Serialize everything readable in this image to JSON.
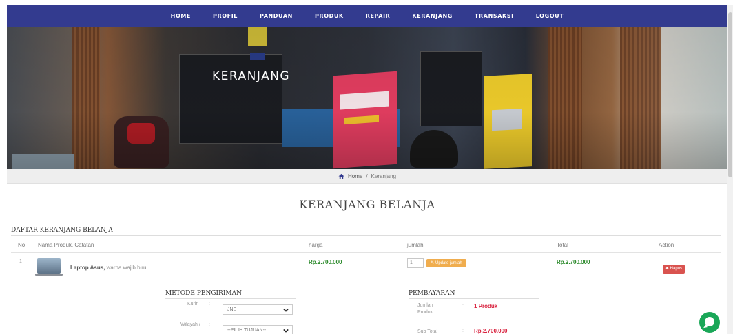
{
  "nav": {
    "items": [
      "HOME",
      "PROFIL",
      "PANDUAN",
      "PRODUK",
      "REPAIR",
      "KERANJANG",
      "TRANSAKSI",
      "LOGOUT"
    ]
  },
  "hero": {
    "title": "KERANJANG"
  },
  "breadcrumb": {
    "icon": "home-icon",
    "home": "Home",
    "separator": "/",
    "current": "Keranjang"
  },
  "page": {
    "heading": "KERANJANG BELANJA"
  },
  "cart": {
    "title": "DAFTAR KERANJANG BELANJA",
    "columns": {
      "no": "No",
      "product": "Nama Produk, Catatan",
      "price": "harga",
      "qty": "jumlah",
      "total": "Total",
      "action": "Action"
    },
    "rows": [
      {
        "no": "1",
        "product_name": "Laptop Asus,",
        "note": "warna wajib biru",
        "price": "Rp.2.700.000",
        "qty": "1",
        "update_label": "Update jumlah",
        "total": "Rp.2.700.000",
        "delete_label": "Hapus"
      }
    ]
  },
  "shipping": {
    "title": "METODE PENGIRIMAN",
    "courier_label": "Kurir",
    "courier_value": "JNE",
    "region_label": "Wilayah /",
    "region_value": "--PILIH TUJUAN--",
    "colon": ":"
  },
  "payment": {
    "title": "PEMBAYARAN",
    "qty_label_1": "Jumlah",
    "qty_label_2": "Produk",
    "qty_value": "1 Produk",
    "subtotal_label": "Sub Total",
    "subtotal_value": "Rp.2.700.000",
    "colon": ":"
  },
  "colors": {
    "navbar": "#333b8f",
    "price": "#2e8b2e",
    "update": "#f0ad4e",
    "delete": "#d9534f",
    "pay_value": "#d9233f",
    "chat": "#1aa758"
  }
}
